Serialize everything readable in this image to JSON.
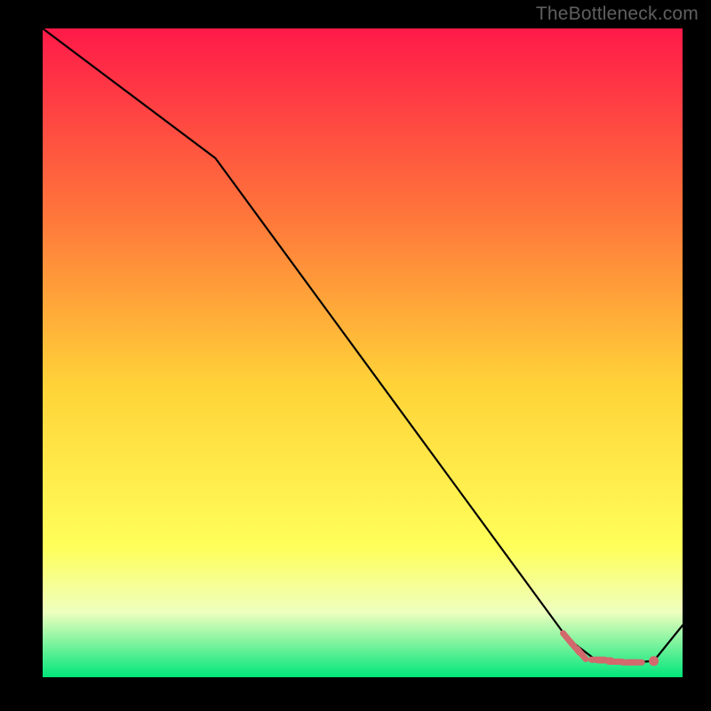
{
  "watermark": "TheBottleneck.com",
  "colors": {
    "background": "#000000",
    "gradient_top": "#ff1a49",
    "gradient_mid_upper": "#ff7a3a",
    "gradient_mid": "#ffd338",
    "gradient_mid_lower": "#ffff5a",
    "gradient_low_band": "#eeffbf",
    "gradient_bottom": "#00e67a",
    "line": "#000000",
    "marker": "#d2696d"
  },
  "chart_data": {
    "type": "line",
    "title": "",
    "xlabel": "",
    "ylabel": "",
    "xlim": [
      0,
      100
    ],
    "ylim": [
      0,
      100
    ],
    "series": [
      {
        "name": "curve",
        "x": [
          0,
          27,
          82,
          86,
          88,
          90,
          92,
          94,
          95.5,
          100
        ],
        "y": [
          100,
          80,
          6,
          3,
          2.5,
          2.3,
          2.3,
          2.4,
          2.5,
          8
        ]
      }
    ],
    "markers": {
      "name": "highlight-dashes",
      "points": [
        {
          "x": 82.0,
          "y": 6.0
        },
        {
          "x": 83.2,
          "y": 4.6
        },
        {
          "x": 84.2,
          "y": 3.6
        },
        {
          "x": 86.8,
          "y": 2.7
        },
        {
          "x": 87.8,
          "y": 2.6
        },
        {
          "x": 89.5,
          "y": 2.4
        },
        {
          "x": 91.6,
          "y": 2.3
        },
        {
          "x": 92.6,
          "y": 2.3
        },
        {
          "x": 95.5,
          "y": 2.5
        }
      ]
    }
  }
}
